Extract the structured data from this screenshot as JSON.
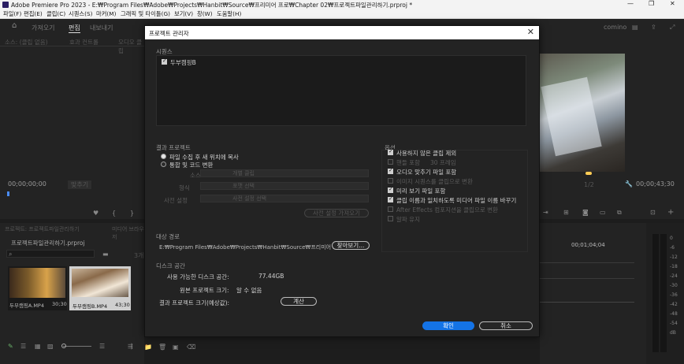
{
  "window": {
    "title": "Adobe Premiere Pro 2023 - E:₩Program Files₩Adobe₩Projects₩Hanbit₩Source₩프리미어 프로₩Chapter 02₩프로젝트파일관리하기.prproj *",
    "minimize": "—",
    "maximize": "❐",
    "close": "✕"
  },
  "menu": [
    "파일(F)",
    "편집(E)",
    "클립(C)",
    "시퀀스(S)",
    "마커(M)",
    "그래픽 및 타이틀(G)",
    "보기(V)",
    "창(W)",
    "도움말(H)"
  ],
  "workspace": {
    "tabs": [
      "가져오기",
      "편집",
      "내보내기"
    ],
    "right_label": "comino"
  },
  "source_panel": {
    "tabs": [
      "소스: (클립 없음)",
      "효과 컨트롤",
      "오디오 클립"
    ],
    "timecode": "00;00;00;00",
    "fit": "맞추기"
  },
  "program_panel": {
    "timecode": "00;00;43;30",
    "zoom": "1/2"
  },
  "project_panel": {
    "tabs": [
      "프로젝트: 프로젝트파일관리하기",
      "미디어 브라우저"
    ],
    "filename": "프로젝트파일관리하기.prproj",
    "item_count": "3개",
    "clips": [
      {
        "name": "두부캠핑A.MP4",
        "duration": "30;30"
      },
      {
        "name": "두부캠핑B.MP4",
        "duration": "43;30"
      }
    ]
  },
  "timeline": {
    "timecode": "00;01;04;04"
  },
  "meter": {
    "ticks": [
      "0",
      "-6",
      "-12",
      "-18",
      "-24",
      "-30",
      "-36",
      "-42",
      "-48",
      "-54",
      "dB"
    ]
  },
  "dialog": {
    "title": "프로젝트 관리자",
    "close_icon": "✕",
    "sequence_section": "시퀀스",
    "sequences": [
      {
        "name": "두부캠핑B",
        "checked": true
      }
    ],
    "result_section": "결과 프로젝트",
    "radio_copy": "파일 수집 후 새 위치에 복사",
    "radio_consolidate": "통합 및 코드 변환",
    "dd_source": "소스",
    "dd_source_value": "개별 클립",
    "dd_format": "형식",
    "dd_format_value": "포맷 선택",
    "dd_preset": "사전 설정",
    "dd_preset_value": "사전 설정 선택",
    "preset_button": "사전 설정 가져오기",
    "options_section": "옵션",
    "options": [
      {
        "label": "사용하지 않은 클립 제외",
        "checked": true,
        "disabled": false
      },
      {
        "label": "핸들 포함",
        "checked": false,
        "disabled": true,
        "extra": "30 프레임"
      },
      {
        "label": "오디오 맞추기 파일 포함",
        "checked": true,
        "disabled": false
      },
      {
        "label": "이미지 시퀀스를 클립으로 변환",
        "checked": false,
        "disabled": true
      },
      {
        "label": "미리 보기 파일 포함",
        "checked": true,
        "disabled": false
      },
      {
        "label": "클립 이름과 일치하도록 미디어 파일 이름 바꾸기",
        "checked": true,
        "disabled": false
      },
      {
        "label": "After Effects 컴포지션을 클립으로 변환",
        "checked": false,
        "disabled": true
      },
      {
        "label": "알파 유지",
        "checked": false,
        "disabled": true
      }
    ],
    "dest_section": "대상 경로",
    "dest_path": "E:₩Program Files₩Adobe₩Projects₩Hanbit₩Source₩프리미어 프로₩C...",
    "browse_button": "찾아보기...",
    "disk_section": "디스크 공간",
    "disk_available_label": "사용 가능한 디스크 공간:",
    "disk_available_value": "77.44GB",
    "orig_size_label": "원본 프로젝트 크기:",
    "orig_size_value": "알 수 없음",
    "result_size_label": "결과 프로젝트 크기(예상값):",
    "calc_button": "계산",
    "ok_button": "확인",
    "cancel_button": "취소"
  }
}
